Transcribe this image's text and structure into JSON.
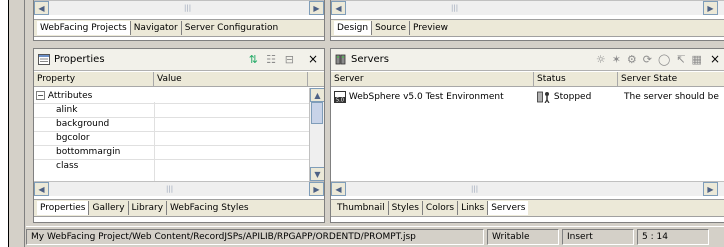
{
  "left_top_tabs": [
    "WebFacing Projects",
    "Navigator",
    "Server Configuration"
  ],
  "right_top_tabs": [
    "Design",
    "Source",
    "Preview"
  ],
  "properties": {
    "title": "Properties",
    "col_property": "Property",
    "col_value": "Value",
    "group": "Attributes",
    "items": [
      "alink",
      "background",
      "bgcolor",
      "bottommargin",
      "class"
    ]
  },
  "properties_tabs": [
    "Properties",
    "Gallery",
    "Library",
    "WebFacing Styles"
  ],
  "servers": {
    "title": "Servers",
    "col_server": "Server",
    "col_status": "Status",
    "col_state": "Server State",
    "row_server": "WebSphere v5.0 Test Environment",
    "row_status": "Stopped",
    "row_state": "The server should be"
  },
  "servers_tabs": [
    "Thumbnail",
    "Styles",
    "Colors",
    "Links",
    "Servers"
  ],
  "status": {
    "path": "My WebFacing Project/Web Content/RecordJSPs/APILIB/RPGAPP/ORDENTD/PROMPT.jsp",
    "writable": "Writable",
    "mode": "Insert",
    "position": "5 : 14"
  },
  "icons": {
    "properties_view": "properties-view-icon",
    "servers_view": "servers-view-icon",
    "server_type": "websphere-server-icon",
    "status_stopped": "stopped-status-icon"
  }
}
